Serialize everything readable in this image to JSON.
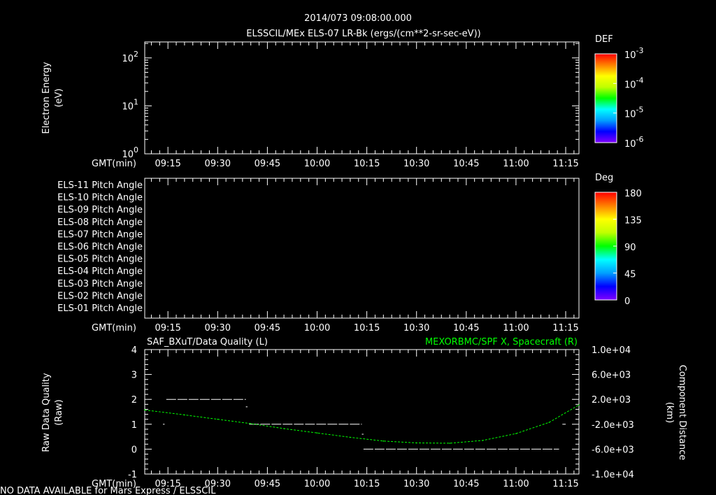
{
  "title": {
    "line1": "2014/073 09:08:00.000",
    "line2": "ELSSCIL/MEx ELS-07 LR-Bk  (ergs/(cm**2-sr-sec-eV))"
  },
  "footer": "NO DATA AVAILABLE for Mars Express / ELSSCIL",
  "colors": {
    "background": "#000000",
    "axes": "#ffffff",
    "spacecraft_x": "#00ff00",
    "data_quality": "#ffffff"
  },
  "chart_data": [
    {
      "type": "heatmap",
      "ylabel": [
        "Electron Energy",
        "(eV)"
      ],
      "yscale": "log",
      "ylim": [
        1,
        215
      ],
      "ytick_bases": [
        "10",
        "10",
        "10"
      ],
      "ytick_exps": [
        "0",
        "1",
        "2"
      ],
      "xlabel": "GMT(min)",
      "xlim": [
        "09:08",
        "11:19"
      ],
      "xticks": [
        "09:15",
        "09:30",
        "09:45",
        "10:00",
        "10:15",
        "10:30",
        "10:45",
        "11:00",
        "11:15"
      ],
      "values": [],
      "colorbar": {
        "title": "DEF",
        "scale": "log",
        "range": [
          1e-06,
          0.001
        ],
        "tick_bases": [
          "10",
          "10",
          "10",
          "10"
        ],
        "tick_exps": [
          "-3",
          "-4",
          "-5",
          "-6"
        ]
      }
    },
    {
      "type": "heatmap",
      "row_labels": [
        "ELS-11 Pitch Angle",
        "ELS-10 Pitch Angle",
        "ELS-09 Pitch Angle",
        "ELS-08 Pitch Angle",
        "ELS-07 Pitch Angle",
        "ELS-06 Pitch Angle",
        "ELS-05 Pitch Angle",
        "ELS-04 Pitch Angle",
        "ELS-03 Pitch Angle",
        "ELS-02 Pitch Angle",
        "ELS-01 Pitch Angle"
      ],
      "xlabel": "GMT(min)",
      "xlim": [
        "09:08",
        "11:19"
      ],
      "xticks": [
        "09:15",
        "09:30",
        "09:45",
        "10:00",
        "10:15",
        "10:30",
        "10:45",
        "11:00",
        "11:15"
      ],
      "values": [],
      "colorbar": {
        "title": "Deg",
        "range": [
          0,
          180
        ],
        "ticks": [
          "180",
          "135",
          "90",
          "45",
          "0"
        ]
      }
    },
    {
      "type": "line",
      "title_left": "SAF_BXuT/Data Quality (L)",
      "title_right": "MEXORBMC/SPF X, Spacecraft (R)",
      "ylabel_left": [
        "Raw Data Quality",
        "(Raw)"
      ],
      "ylabel_right": [
        "Component Distance",
        "(km)"
      ],
      "ylim_left": [
        -1,
        4
      ],
      "yticks_left": [
        "4",
        "3",
        "2",
        "1",
        "0",
        "-1"
      ],
      "ylim_right": [
        -10000,
        10000
      ],
      "yticks_right": [
        "1.0e+04",
        "6.0e+03",
        "2.0e+03",
        "-2.0e+03",
        "-6.0e+03",
        "-1.0e+04"
      ],
      "xlabel": "GMT(min)",
      "xlim": [
        "09:08",
        "11:19"
      ],
      "xticks": [
        "09:15",
        "09:30",
        "09:45",
        "10:00",
        "10:15",
        "10:30",
        "10:45",
        "11:00",
        "11:15"
      ],
      "series": [
        {
          "name": "SAF_BXuT/Data Quality",
          "axis": "left",
          "segments": [
            {
              "start": "09:13:30",
              "end": "09:14:00",
              "value": 1
            },
            {
              "start": "09:14:30",
              "end": "09:38:30",
              "value": 2
            },
            {
              "start": "09:38:30",
              "end": "09:39:00",
              "value": 1.7
            },
            {
              "start": "09:39:30",
              "end": "10:13:30",
              "value": 1
            },
            {
              "start": "10:13:30",
              "end": "10:14:00",
              "value": 0.6
            },
            {
              "start": "10:14:00",
              "end": "11:13:00",
              "value": 0
            },
            {
              "start": "11:14:00",
              "end": "11:15:00",
              "value": 1
            }
          ]
        },
        {
          "name": "MEXORBMC/SPF X, Spacecraft",
          "axis": "right",
          "x": [
            "09:08",
            "09:20",
            "09:30",
            "09:40",
            "09:50",
            "10:00",
            "10:10",
            "10:20",
            "10:30",
            "10:40",
            "10:50",
            "11:00",
            "11:10",
            "11:19"
          ],
          "y": [
            300,
            -500,
            -1200,
            -1900,
            -2700,
            -3400,
            -4100,
            -4700,
            -5000,
            -5050,
            -4600,
            -3500,
            -1700,
            1100
          ]
        }
      ]
    }
  ]
}
